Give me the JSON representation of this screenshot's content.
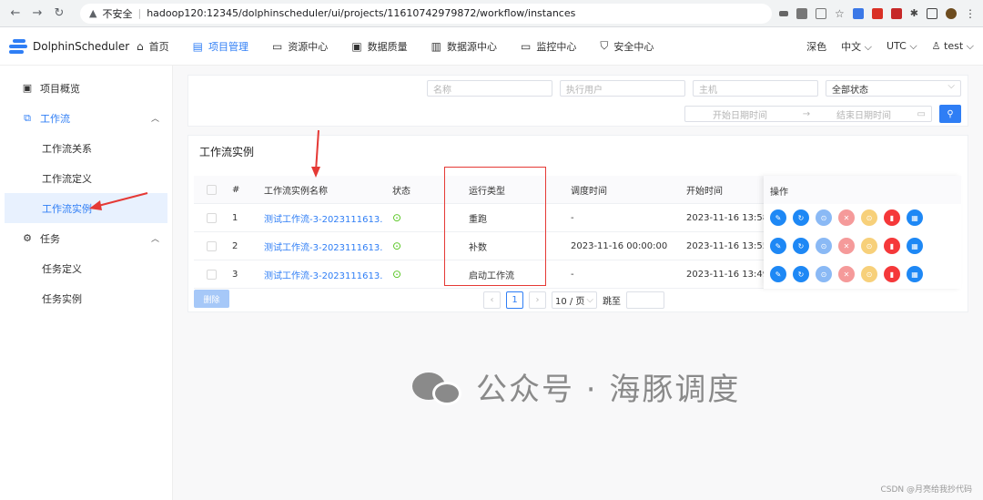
{
  "browser": {
    "security_label": "不安全",
    "url": "hadoop120:12345/dolphinscheduler/ui/projects/11610742979872/workflow/instances"
  },
  "header": {
    "logo_text": "DolphinScheduler",
    "nav": [
      {
        "label": "首页",
        "icon": "home-icon"
      },
      {
        "label": "项目管理",
        "icon": "project-icon",
        "active": true
      },
      {
        "label": "资源中心",
        "icon": "folder-icon"
      },
      {
        "label": "数据质量",
        "icon": "quality-icon"
      },
      {
        "label": "数据源中心",
        "icon": "datasource-icon"
      },
      {
        "label": "监控中心",
        "icon": "monitor-icon"
      },
      {
        "label": "安全中心",
        "icon": "security-icon"
      }
    ],
    "theme": "深色",
    "language": "中文",
    "timezone": "UTC",
    "user": "test"
  },
  "sidebar": {
    "overview": "项目概览",
    "workflow": "工作流",
    "workflow_relation": "工作流关系",
    "workflow_definition": "工作流定义",
    "workflow_instance": "工作流实例",
    "task": "任务",
    "task_definition": "任务定义",
    "task_instance": "任务实例"
  },
  "search": {
    "name_placeholder": "名称",
    "executor_placeholder": "执行用户",
    "host_placeholder": "主机",
    "state_value": "全部状态",
    "start_date_placeholder": "开始日期时间",
    "end_date_placeholder": "结束日期时间"
  },
  "list": {
    "title": "工作流实例",
    "columns": {
      "index": "#",
      "name": "工作流实例名称",
      "state": "状态",
      "run_type": "运行类型",
      "schedule_time": "调度时间",
      "start_time": "开始时间",
      "operations": "操作"
    },
    "rows": [
      {
        "index": "1",
        "name": "测试工作流-3-2023111613...",
        "run_type": "重跑",
        "schedule_time": "-",
        "start_time": "2023-11-16 13:58:"
      },
      {
        "index": "2",
        "name": "测试工作流-3-2023111613...",
        "run_type": "补数",
        "schedule_time": "2023-11-16 00:00:00",
        "start_time": "2023-11-16 13:55:"
      },
      {
        "index": "3",
        "name": "测试工作流-3-2023111613...",
        "run_type": "启动工作流",
        "schedule_time": "-",
        "start_time": "2023-11-16 13:49:"
      }
    ],
    "op_colors": [
      "#1e88f5",
      "#1e88f5",
      "#8ab9f5",
      "#f59a9a",
      "#f7d07a",
      "#f5383a",
      "#1e88f5"
    ],
    "delete_label": "删除",
    "pager": {
      "current": "1",
      "page_size": "10 / 页",
      "jump_label": "跳至"
    }
  },
  "watermark": {
    "text": "公众号 · 海豚调度",
    "credit": "CSDN @月亮给我抄代码"
  }
}
